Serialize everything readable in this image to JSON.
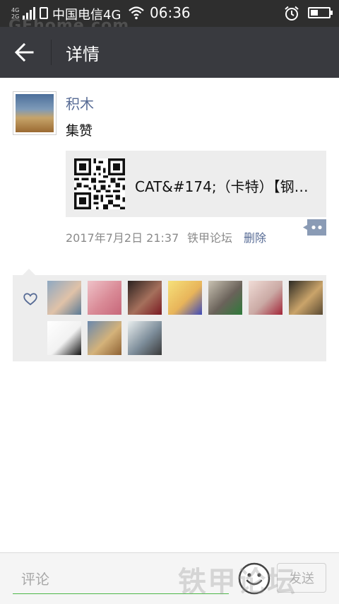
{
  "status_bar": {
    "net_top": "4G",
    "net_bottom": "2G",
    "carrier": "中国电信4G",
    "time": "06:36",
    "battery_level": 0.4
  },
  "watermark_top": "GEhome.com",
  "title_bar": {
    "back_icon": "arrow-left-icon",
    "title": "详情"
  },
  "post": {
    "username": "积木",
    "text": "集赞",
    "link_card": {
      "title": "CAT&#174;（卡特）【钢…",
      "thumb_icon": "qr-code-icon"
    },
    "time": "2017年7月2日 21:37",
    "source": "铁甲论坛",
    "delete_label": "删除",
    "more_icon": "more-dots-icon"
  },
  "likes": {
    "icon": "heart-outline-icon",
    "likers": [
      {
        "name": "liker-1",
        "colors": [
          "#8ea8c2",
          "#e0c2a8",
          "#5a7a95"
        ]
      },
      {
        "name": "liker-2",
        "colors": [
          "#efc2c8",
          "#d98a96",
          "#c7677a"
        ]
      },
      {
        "name": "liker-3",
        "colors": [
          "#2b2220",
          "#a5705c",
          "#7a1a22"
        ]
      },
      {
        "name": "liker-4",
        "colors": [
          "#f6e17a",
          "#e8b45a",
          "#3e4ab8"
        ]
      },
      {
        "name": "liker-5",
        "colors": [
          "#c9c2b2",
          "#6a625a",
          "#2f7a3a"
        ]
      },
      {
        "name": "liker-6",
        "colors": [
          "#f0dcd6",
          "#caa9a4",
          "#a22538"
        ]
      },
      {
        "name": "liker-7",
        "colors": [
          "#2c2a24",
          "#caa46a",
          "#5a4a32"
        ]
      },
      {
        "name": "liker-8",
        "colors": [
          "#ffffff",
          "#f2f2f2",
          "#111111"
        ]
      },
      {
        "name": "liker-9",
        "colors": [
          "#6a88ad",
          "#d4b27a",
          "#8e6234"
        ]
      },
      {
        "name": "liker-10",
        "colors": [
          "#e9eeee",
          "#7d8d9a",
          "#3a3a3a"
        ]
      }
    ]
  },
  "input_bar": {
    "placeholder": "评论",
    "emoji_icon": "emoji-icon",
    "send_label": "发送"
  },
  "watermark_bottom": "铁甲论坛"
}
